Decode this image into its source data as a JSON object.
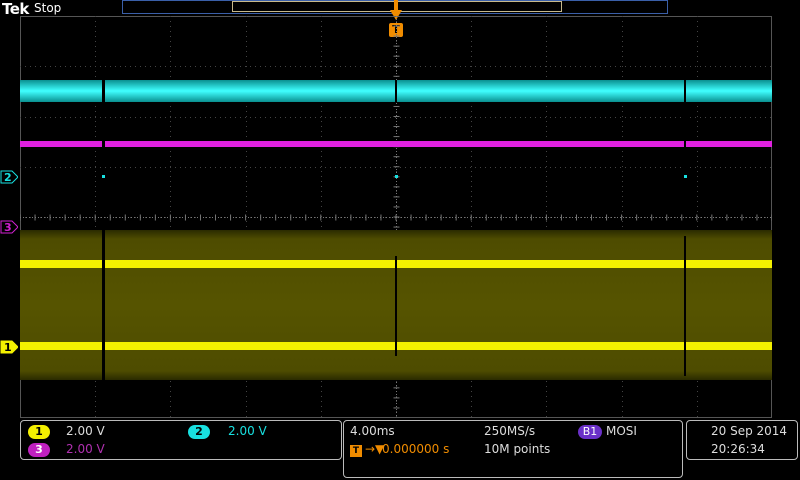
{
  "header": {
    "brand": "Tek",
    "run_state": "Stop"
  },
  "trigger": {
    "marker": "T",
    "position_icon": "trigger-position-arrow-icon",
    "color": "#f08c00"
  },
  "channels": [
    {
      "id": "1",
      "scale": "2.00 V",
      "color": "#f4f000"
    },
    {
      "id": "2",
      "scale": "2.00 V",
      "color": "#18e0e0"
    },
    {
      "id": "3",
      "scale": "2.00 V",
      "color": "#c020c0"
    }
  ],
  "timebase": {
    "horizontal_scale": "4.00ms",
    "sample_rate": "250MS/s",
    "trigger_delay": "0.000000 s",
    "record_length": "10M points",
    "trigger_icon": "T",
    "trigger_arrow": "→▼"
  },
  "bus": {
    "badge": "B1",
    "label": "MOSI",
    "color": "#6a30c8"
  },
  "datetime": {
    "date": "20 Sep  2014",
    "time": "20:26:34"
  }
}
